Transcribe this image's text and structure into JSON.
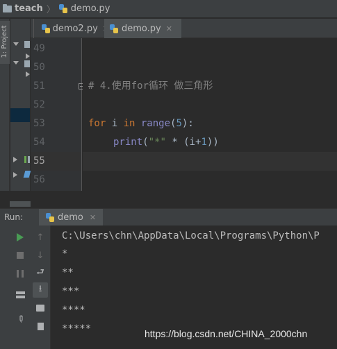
{
  "breadcrumb": {
    "project": "teach",
    "file": "demo.py"
  },
  "tool_strip": {
    "project_tab": "1: Project"
  },
  "tabs": [
    {
      "label": "demo2.py",
      "active": false
    },
    {
      "label": "demo.py",
      "active": true
    }
  ],
  "editor": {
    "lines": [
      {
        "number": "49"
      },
      {
        "number": "50"
      },
      {
        "number": "51",
        "comment": "# 4.使用for循环 做三角形"
      },
      {
        "number": "52"
      },
      {
        "number": "53",
        "kw": "for",
        "var": " i ",
        "kw2": "in",
        "builtin": " range",
        "open": "(",
        "num": "5",
        "close": "):"
      },
      {
        "number": "54",
        "builtin": "print",
        "open": "(",
        "str": "\"*\"",
        "rest": " * (i+",
        "num": "1",
        "close": "))"
      },
      {
        "number": "55",
        "current": true
      },
      {
        "number": "56"
      }
    ]
  },
  "run": {
    "label": "Run:",
    "tab": "demo",
    "console_lines": [
      "C:\\Users\\chn\\AppData\\Local\\Programs\\Python\\P",
      "*",
      "**",
      "***",
      "****",
      "*****"
    ],
    "watermark": "https://blog.csdn.net/CHINA_2000chn"
  },
  "colors": {
    "keyword": "#cc7832",
    "comment": "#808080",
    "number": "#6897bb",
    "string": "#6a8759",
    "builtin": "#8888c6",
    "run_green": "#499c54"
  }
}
